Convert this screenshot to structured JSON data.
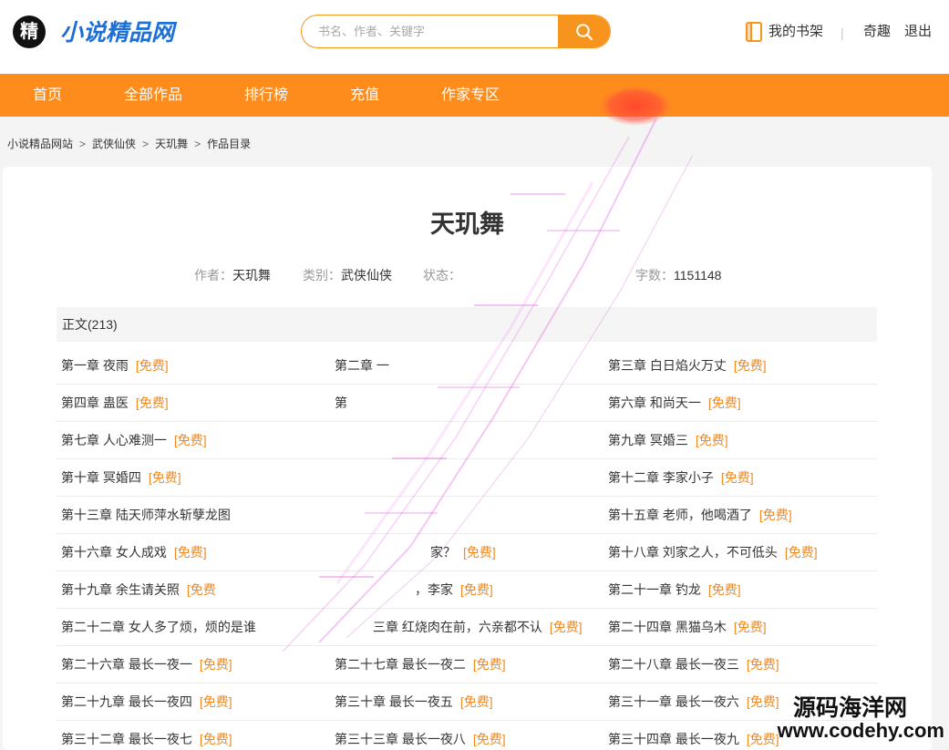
{
  "theme": {
    "accent": "#f7941d",
    "nav_bg": "#fe8c1c",
    "brand_blue": "#1b6fd6",
    "free_tag": "#f0891f"
  },
  "header": {
    "logo_char": "精",
    "site_name": "小说精品网",
    "search": {
      "placeholder": "书名、作者、关键字",
      "icon": "search-icon"
    },
    "bookshelf": {
      "icon": "book-icon",
      "label": "我的书架"
    },
    "separator": "|",
    "links": [
      "奇趣",
      "退出"
    ]
  },
  "nav": {
    "items": [
      "首页",
      "全部作品",
      "排行榜",
      "充值",
      "作家专区"
    ]
  },
  "breadcrumb": {
    "items": [
      "小说精品网站",
      "武侠仙侠",
      "天玑舞",
      "作品目录"
    ],
    "separator": ">"
  },
  "book": {
    "title": "天玑舞",
    "meta": {
      "author_label": "作者：",
      "author": "天玑舞",
      "category_label": "类别：",
      "category": "武侠仙侠",
      "status_label": "状态：",
      "word_count_label": "字数：",
      "word_count": "1151148"
    }
  },
  "toc": {
    "section_title": "正文(213)",
    "chapters": [
      {
        "title": "第一章 夜雨",
        "tag": "[免费]"
      },
      {
        "title": "第二章 一",
        "tag": ""
      },
      {
        "title": "第三章 白日焰火万丈",
        "tag": "[免费]"
      },
      {
        "title": "第四章 蛊医",
        "tag": "[免费]"
      },
      {
        "title": "第",
        "tag": ""
      },
      {
        "title": "第六章 和尚天一",
        "tag": "[免费]"
      },
      {
        "title": "第七章 人心难测一",
        "tag": "[免费]"
      },
      {
        "title": "",
        "tag": ""
      },
      {
        "title": "第九章 冥婚三",
        "tag": "[免费]"
      },
      {
        "title": "第十章 冥婚四",
        "tag": "[免费]"
      },
      {
        "title": "",
        "tag": ""
      },
      {
        "title": "第十二章 李家小子",
        "tag": "[免费]"
      },
      {
        "title": "第十三章 陆天师萍水斩孽龙图",
        "tag": ""
      },
      {
        "title": "",
        "tag": ""
      },
      {
        "title": "第十五章 老师，他喝酒了",
        "tag": "[免费]"
      },
      {
        "title": "第十六章 女人成戏",
        "tag": "[免费]"
      },
      {
        "title": "家？",
        "tag": "[免费]"
      },
      {
        "title": "第十八章 刘家之人，不可低头",
        "tag": "[免费]"
      },
      {
        "title": "第十九章 余生请关照",
        "tag": "[免费"
      },
      {
        "title": "，李家",
        "tag": "[免费]"
      },
      {
        "title": "第二十一章 钓龙",
        "tag": "[免费]"
      },
      {
        "title": "第二十二章 女人多了烦，烦的是谁",
        "tag": ""
      },
      {
        "title": "三章 红烧肉在前，六亲都不认",
        "tag": "[免费]"
      },
      {
        "title": "第二十四章 黑猫乌木",
        "tag": "[免费]"
      },
      {
        "title": "第二十六章 最长一夜一",
        "tag": "[免费]"
      },
      {
        "title": "第二十七章 最长一夜二",
        "tag": "[免费]"
      },
      {
        "title": "第二十八章 最长一夜三",
        "tag": "[免费]"
      },
      {
        "title": "第二十九章 最长一夜四",
        "tag": "[免费]"
      },
      {
        "title": "第三十章 最长一夜五",
        "tag": "[免费]"
      },
      {
        "title": "第三十一章 最长一夜六",
        "tag": "[免费]"
      },
      {
        "title": "第三十二章 最长一夜七",
        "tag": "[免费]"
      },
      {
        "title": "第三十三章 最长一夜八",
        "tag": "[免费]"
      },
      {
        "title": "第三十四章 最长一夜九",
        "tag": "[免费]"
      }
    ]
  },
  "watermark": {
    "line1": "源码海洋网",
    "line2": "www.codehy.com"
  }
}
